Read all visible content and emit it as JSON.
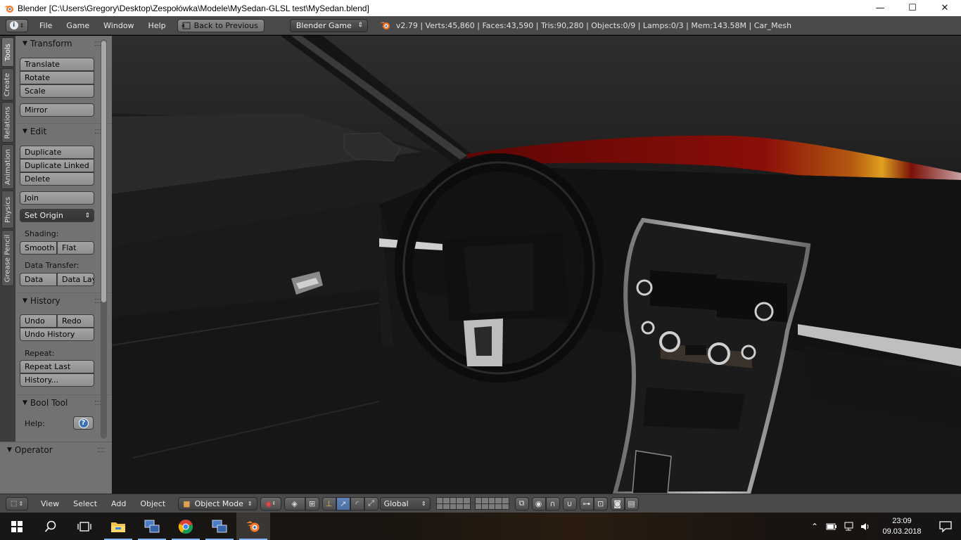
{
  "window": {
    "title": "Blender [C:\\Users\\Gregory\\Desktop\\Zespołówka\\Modele\\MySedan-GLSL test\\MySedan.blend]",
    "controls": {
      "minimize": "—",
      "maximize": "☐",
      "close": "✕"
    }
  },
  "info_header": {
    "menus": [
      "File",
      "Game",
      "Window",
      "Help"
    ],
    "back_button": "Back to Previous",
    "engine": "Blender Game",
    "stats": "v2.79 | Verts:45,860 | Faces:43,590 | Tris:90,280 | Objects:0/9 | Lamps:0/3 | Mem:143.58M | Car_Mesh"
  },
  "tool_tabs": [
    "Tools",
    "Create",
    "Relations",
    "Animation",
    "Physics",
    "Grease Pencil"
  ],
  "tool_panel": {
    "transform": {
      "title": "Transform",
      "buttons": [
        "Translate",
        "Rotate",
        "Scale"
      ],
      "mirror": "Mirror"
    },
    "edit": {
      "title": "Edit",
      "buttons": [
        "Duplicate",
        "Duplicate Linked",
        "Delete"
      ],
      "join": "Join",
      "set_origin": "Set Origin",
      "shading_label": "Shading:",
      "smooth": "Smooth",
      "flat": "Flat",
      "data_transfer_label": "Data Transfer:",
      "data": "Data",
      "data_layout": "Data Lay"
    },
    "history": {
      "title": "History",
      "undo": "Undo",
      "redo": "Redo",
      "undo_history": "Undo History",
      "repeat_label": "Repeat:",
      "repeat_last": "Repeat Last",
      "history_more": "History..."
    },
    "bool_tool": {
      "title": "Bool Tool",
      "help_label": "Help:",
      "help_icon": "?"
    }
  },
  "operator_panel": {
    "title": "Operator"
  },
  "view3d_header": {
    "menus": [
      "View",
      "Select",
      "Add",
      "Object"
    ],
    "mode": "Object Mode",
    "orientation": "Global"
  },
  "taskbar": {
    "apps": [
      "start",
      "search",
      "task-view",
      "file-explorer",
      "remote-desktop",
      "chrome",
      "remote-desktop-2",
      "blender"
    ],
    "time": "23:09",
    "date": "09.03.2018"
  },
  "colors": {
    "panel_bg": "#727272",
    "header_bg": "#4a4a4a",
    "viewport_bg": "#1e1e1e",
    "car_roof_red": "#7a0a08",
    "accent_blue": "#5d83b8"
  }
}
